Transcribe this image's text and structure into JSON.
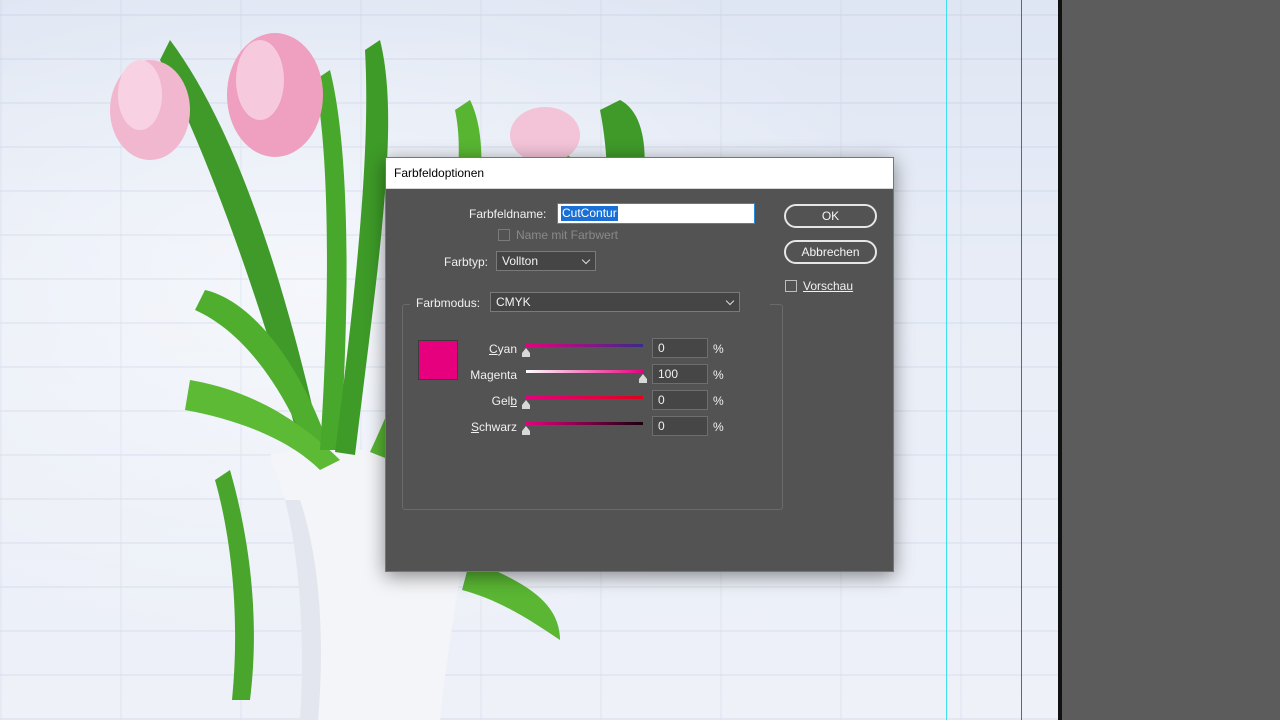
{
  "dialog": {
    "title": "Farbfeldoptionen",
    "swatch_name_label": "Farbfeldname:",
    "swatch_name_value": "CutContur",
    "name_with_value_label": "Name mit Farbwert",
    "color_type_label": "Farbtyp:",
    "color_type_value": "Vollton",
    "color_mode_label": "Farbmodus:",
    "color_mode_value": "CMYK",
    "ok_label": "OK",
    "cancel_label": "Abbrechen",
    "preview_label": "Vorschau",
    "swatch_color": "#e6007e",
    "percent_symbol": "%",
    "channels": [
      {
        "label": "Cyan",
        "value": "0",
        "level": 0
      },
      {
        "label": "Magenta",
        "value": "100",
        "level": 100
      },
      {
        "label": "Gelb",
        "value": "0",
        "level": 0
      },
      {
        "label": "Schwarz",
        "value": "0",
        "level": 0
      }
    ]
  },
  "colors": {
    "accent": "#2a8ad6",
    "dialog_bg": "#535353",
    "guide_cyan": "#3ee0f0",
    "guide_purple": "#9a35e6"
  }
}
